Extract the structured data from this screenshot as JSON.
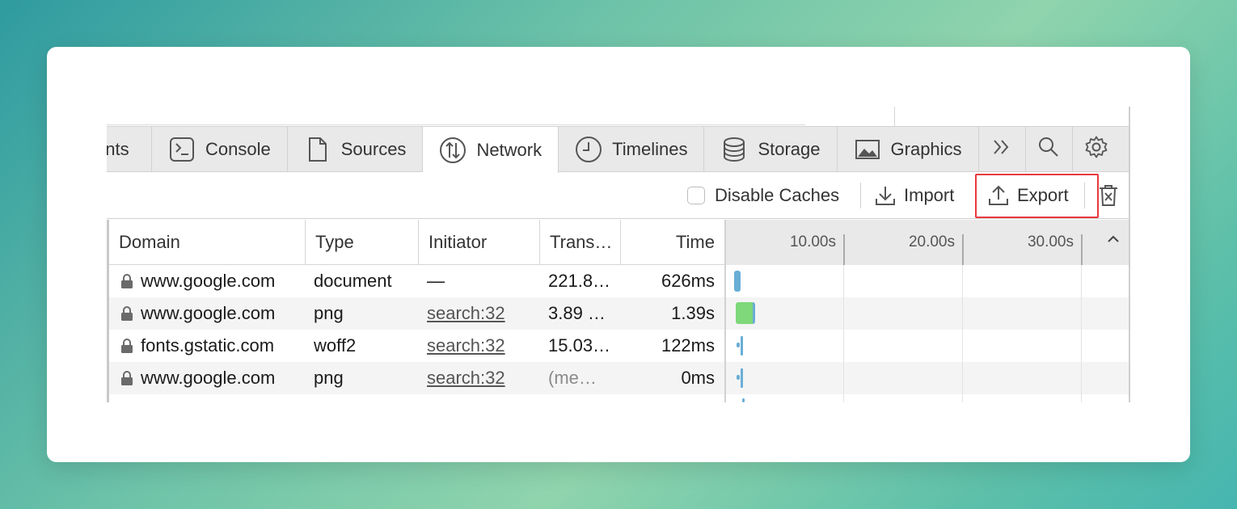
{
  "tabs": [
    {
      "label": "ents",
      "icon": "none"
    },
    {
      "label": "Console",
      "icon": "console-icon"
    },
    {
      "label": "Sources",
      "icon": "document-icon"
    },
    {
      "label": "Network",
      "icon": "network-icon",
      "active": true
    },
    {
      "label": "Timelines",
      "icon": "clock-icon"
    },
    {
      "label": "Storage",
      "icon": "database-icon"
    },
    {
      "label": "Graphics",
      "icon": "image-icon"
    }
  ],
  "toolbar": {
    "disable_caches_label": "Disable Caches",
    "import_label": "Import",
    "export_label": "Export"
  },
  "table": {
    "headers": {
      "domain": "Domain",
      "type": "Type",
      "initiator": "Initiator",
      "transferred": "Trans…",
      "time": "Time"
    },
    "timeline_ticks": [
      "10.00s",
      "20.00s",
      "30.00s"
    ],
    "rows": [
      {
        "domain": "www.google.com",
        "type": "document",
        "initiator": "—",
        "initiator_link": false,
        "transferred": "221.8…",
        "transferred_muted": false,
        "time": "626ms"
      },
      {
        "domain": "www.google.com",
        "type": "png",
        "initiator": "search:32",
        "initiator_link": true,
        "transferred": "3.89 …",
        "transferred_muted": false,
        "time": "1.39s"
      },
      {
        "domain": "fonts.gstatic.com",
        "type": "woff2",
        "initiator": "search:32",
        "initiator_link": true,
        "transferred": "15.03…",
        "transferred_muted": false,
        "time": "122ms"
      },
      {
        "domain": "www.google.com",
        "type": "png",
        "initiator": "search:32",
        "initiator_link": true,
        "transferred": "(me…",
        "transferred_muted": true,
        "time": "0ms"
      }
    ]
  },
  "colors": {
    "accent_blue": "#6aaed6",
    "accent_green": "#7fd87a",
    "highlight_red": "#e8393f"
  }
}
